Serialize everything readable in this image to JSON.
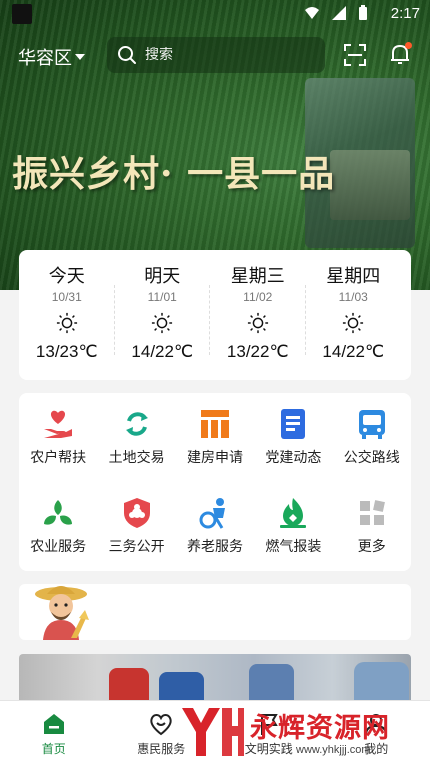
{
  "status": {
    "time": "2:17"
  },
  "header": {
    "district": "华容区",
    "search_placeholder": "搜索"
  },
  "banner": {
    "title": "振兴乡村· 一县一品"
  },
  "weather": [
    {
      "name": "今天",
      "date": "10/31",
      "temp": "13/23℃",
      "icon": "sun-icon"
    },
    {
      "name": "明天",
      "date": "11/01",
      "temp": "14/22℃",
      "icon": "sun-icon"
    },
    {
      "name": "星期三",
      "date": "11/02",
      "temp": "13/22℃",
      "icon": "sun-icon"
    },
    {
      "name": "星期四",
      "date": "11/03",
      "temp": "14/22℃",
      "icon": "sun-icon"
    }
  ],
  "services": [
    {
      "label": "农户帮扶",
      "icon": "heart-hand-icon"
    },
    {
      "label": "土地交易",
      "icon": "exchange-icon"
    },
    {
      "label": "建房申请",
      "icon": "building-icon"
    },
    {
      "label": "党建动态",
      "icon": "document-icon"
    },
    {
      "label": "公交路线",
      "icon": "bus-icon"
    },
    {
      "label": "农业服务",
      "icon": "sprout-icon"
    },
    {
      "label": "三务公开",
      "icon": "shield-icon"
    },
    {
      "label": "养老服务",
      "icon": "elderly-care-icon"
    },
    {
      "label": "燃气报装",
      "icon": "gas-icon"
    },
    {
      "label": "更多",
      "icon": "more-grid-icon"
    }
  ],
  "bottom_nav": [
    {
      "label": "首页",
      "icon": "home-icon",
      "active": true
    },
    {
      "label": "惠民服务",
      "icon": "heart-smile-icon",
      "active": false
    },
    {
      "label": "文明实践",
      "icon": "flag-icon",
      "active": false
    },
    {
      "label": "我的",
      "icon": "user-icon",
      "active": false
    }
  ],
  "watermark": {
    "text": "永辉资源网",
    "url": "www.yhkjjj.com"
  },
  "colors": {
    "primary_green": "#188a40",
    "banner_title": "#f3e6b9"
  }
}
